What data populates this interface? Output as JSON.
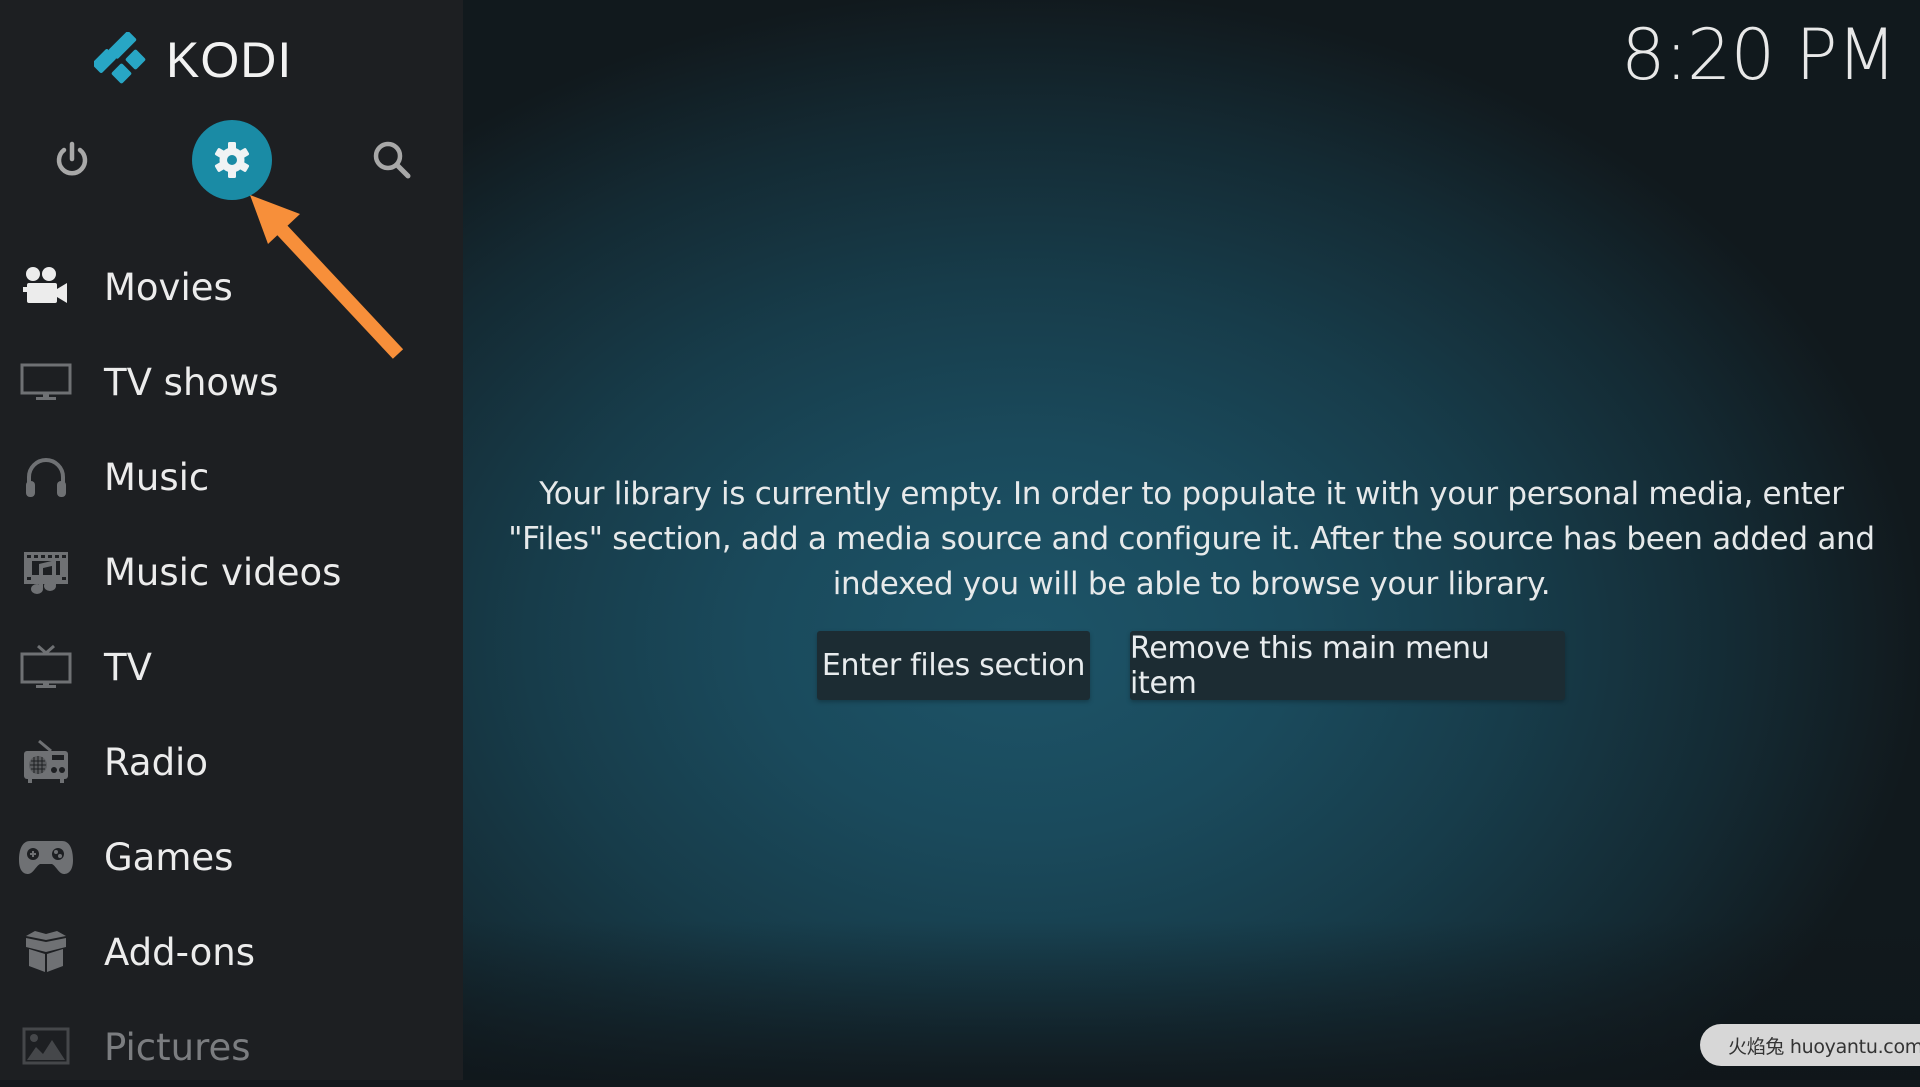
{
  "app": {
    "title": "KODI",
    "accent_color": "#1a8ba5",
    "annotation_color": "#f78f3a"
  },
  "header": {
    "clock": "8:20 PM"
  },
  "top_buttons": [
    {
      "name": "power",
      "icon": "power-icon"
    },
    {
      "name": "settings",
      "icon": "gear-icon",
      "highlighted": true
    },
    {
      "name": "search",
      "icon": "search-icon"
    }
  ],
  "sidebar": {
    "items": [
      {
        "label": "Movies",
        "icon": "movie-camera-icon"
      },
      {
        "label": "TV shows",
        "icon": "monitor-icon"
      },
      {
        "label": "Music",
        "icon": "headphones-icon"
      },
      {
        "label": "Music videos",
        "icon": "music-video-icon"
      },
      {
        "label": "TV",
        "icon": "tv-antenna-icon"
      },
      {
        "label": "Radio",
        "icon": "radio-icon"
      },
      {
        "label": "Games",
        "icon": "gamepad-icon"
      },
      {
        "label": "Add-ons",
        "icon": "box-icon"
      },
      {
        "label": "Pictures",
        "icon": "picture-icon"
      }
    ]
  },
  "main": {
    "message_lines": [
      "Your library is currently empty. In order to populate it with your personal media, enter",
      "\"Files\" section, add a media source and configure it. After the source has been added and",
      "indexed you will be able to browse your library."
    ],
    "buttons": {
      "enter_files": "Enter files section",
      "remove_item": "Remove this main menu item"
    }
  },
  "watermark": {
    "text": "火焰兔 huoyantu.com"
  }
}
